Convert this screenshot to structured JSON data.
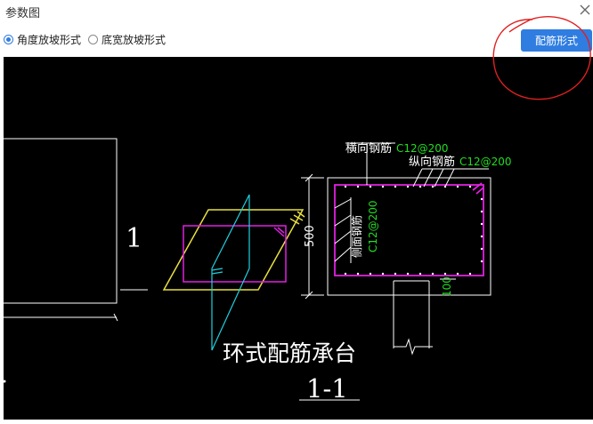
{
  "dialog": {
    "title": "参数图"
  },
  "options": [
    {
      "label": "角度放坡形式",
      "selected": true
    },
    {
      "label": "底宽放坡形式",
      "selected": false
    }
  ],
  "action_button": {
    "label": "配筋形式"
  },
  "drawing": {
    "section_mark": "1",
    "horizontal_rebar_label": "横向钢筋",
    "horizontal_rebar_value": "C12@200",
    "longitudinal_rebar_label": "纵向钢筋",
    "longitudinal_rebar_value": "C12@200",
    "side_rebar_label": "侧面钢筋",
    "side_rebar_value": "C12@200",
    "dim_height": "500",
    "dim_cover": "100",
    "caption": "环式配筋承台",
    "section_title": "1-1"
  },
  "colors": {
    "accent": "#2f7de1",
    "canvas_bg": "#000000",
    "rebar_magenta": "#e020e0",
    "dim_green": "#22dd22",
    "yellow": "#e8e040",
    "cyan": "#20d0e0",
    "annotation_red": "#e02020"
  }
}
